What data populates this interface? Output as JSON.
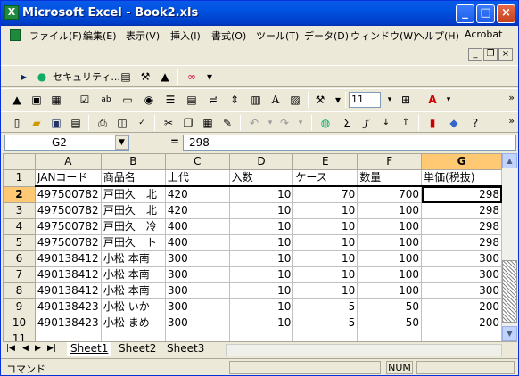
{
  "window": {
    "title": "Microsoft Excel - Book2.xls"
  },
  "menu": [
    "ファイル(F)",
    "編集(E)",
    "表示(V)",
    "挿入(I)",
    "書式(O)",
    "ツール(T)",
    "データ(D)",
    "ウィンドウ(W)",
    "ヘルプ(H)",
    "Acrobat"
  ],
  "toolbar": {
    "security_label": "セキュリティ...",
    "font_size": "11"
  },
  "formula": {
    "cell_ref": "G2",
    "equals": "=",
    "value": "298"
  },
  "columns": [
    "A",
    "B",
    "C",
    "D",
    "E",
    "F",
    "G"
  ],
  "rows": [
    [
      "JANコード",
      "商品名",
      "上代",
      "入数",
      "ケース",
      "数量",
      "単価(税抜)"
    ],
    [
      "497500782",
      "戸田久　北",
      "420",
      "10",
      "70",
      "700",
      "298"
    ],
    [
      "497500782",
      "戸田久　北",
      "420",
      "10",
      "10",
      "100",
      "298"
    ],
    [
      "497500782",
      "戸田久　冷",
      "400",
      "10",
      "10",
      "100",
      "298"
    ],
    [
      "497500782",
      "戸田久　ト",
      "400",
      "10",
      "10",
      "100",
      "298"
    ],
    [
      "490138412",
      "小松 本南",
      "300",
      "10",
      "10",
      "100",
      "300"
    ],
    [
      "490138412",
      "小松 本南",
      "300",
      "10",
      "10",
      "100",
      "300"
    ],
    [
      "490138412",
      "小松 本南",
      "300",
      "10",
      "10",
      "100",
      "300"
    ],
    [
      "490138423",
      "小松 いか",
      "300",
      "10",
      "5",
      "50",
      "200"
    ],
    [
      "490138423",
      "小松 まめ",
      "300",
      "10",
      "5",
      "50",
      "200"
    ],
    [
      "",
      "",
      "",
      "",
      "",
      "",
      ""
    ]
  ],
  "row_numbers": [
    "1",
    "2",
    "3",
    "4",
    "5",
    "6",
    "7",
    "8",
    "9",
    "10",
    "11"
  ],
  "sheets": [
    "Sheet1",
    "Sheet2",
    "Sheet3"
  ],
  "status": {
    "mode": "コマンド",
    "num": "NUM"
  }
}
